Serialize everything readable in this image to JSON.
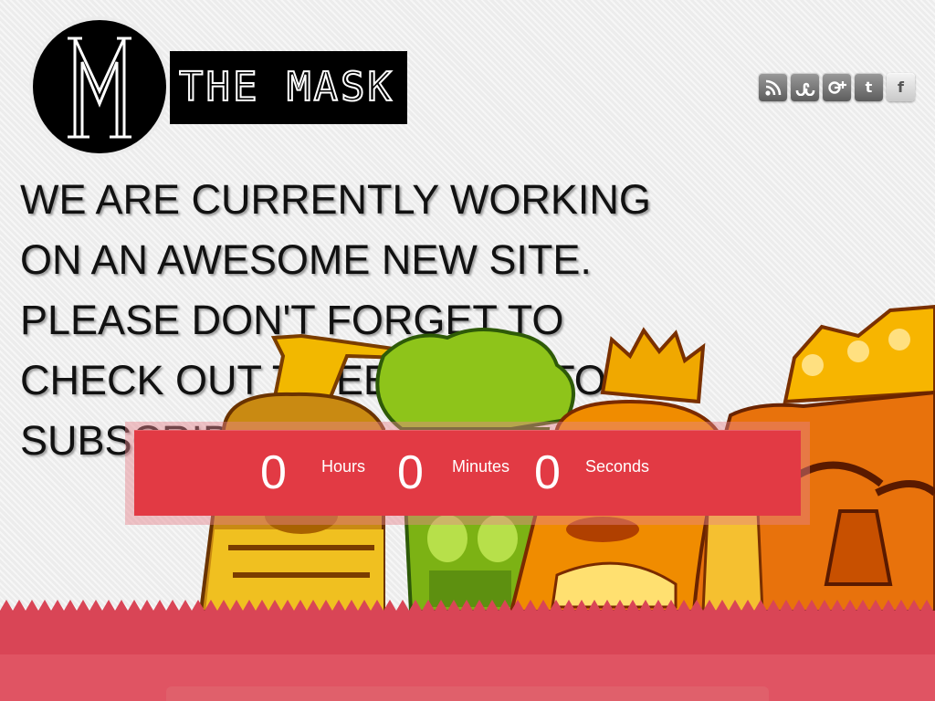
{
  "brand": {
    "name": "THE MASK",
    "monogram": "M"
  },
  "social": [
    {
      "id": "rss",
      "icon": "rss-icon"
    },
    {
      "id": "stumbleupon",
      "icon": "stumbleupon-icon"
    },
    {
      "id": "googleplus",
      "icon": "googleplus-icon"
    },
    {
      "id": "twitter",
      "icon": "twitter-icon",
      "glyph": "t"
    },
    {
      "id": "facebook",
      "icon": "facebook-icon",
      "glyph": "f"
    }
  ],
  "headline": "We are currently working on an awesome new site. Please don't forget to check out tweets and to subscribe",
  "countdown": {
    "hours": "0",
    "hours_label": "Hours",
    "minutes": "0",
    "minutes_label": "Minutes",
    "seconds": "0",
    "seconds_label": "Seconds"
  },
  "colors": {
    "accent_red": "#e23a44",
    "band_red": "#d94556",
    "background": "#ececec"
  }
}
